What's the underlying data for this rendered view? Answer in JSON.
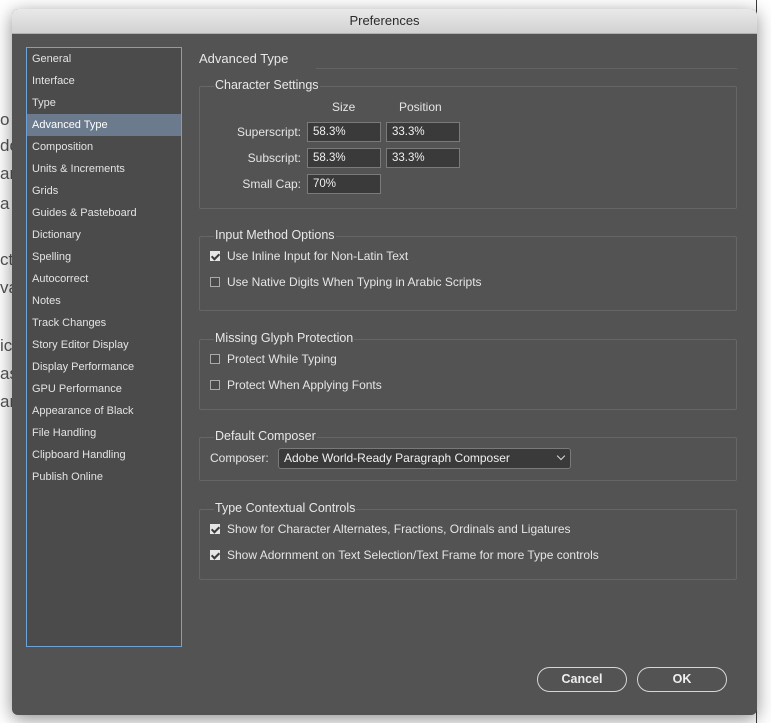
{
  "window": {
    "title": "Preferences"
  },
  "background_fragments": [
    "o",
    "do",
    "an",
    "a",
    "ct",
    "va",
    "ic",
    "as",
    "ar"
  ],
  "sidebar": {
    "items": [
      {
        "label": "General"
      },
      {
        "label": "Interface"
      },
      {
        "label": "Type"
      },
      {
        "label": "Advanced Type",
        "selected": true
      },
      {
        "label": "Composition"
      },
      {
        "label": "Units & Increments"
      },
      {
        "label": "Grids"
      },
      {
        "label": "Guides & Pasteboard"
      },
      {
        "label": "Dictionary"
      },
      {
        "label": "Spelling"
      },
      {
        "label": "Autocorrect"
      },
      {
        "label": "Notes"
      },
      {
        "label": "Track Changes"
      },
      {
        "label": "Story Editor Display"
      },
      {
        "label": "Display Performance"
      },
      {
        "label": "GPU Performance"
      },
      {
        "label": "Appearance of Black"
      },
      {
        "label": "File Handling"
      },
      {
        "label": "Clipboard Handling"
      },
      {
        "label": "Publish Online"
      }
    ]
  },
  "panel": {
    "title": "Advanced Type",
    "character_settings": {
      "title": "Character Settings",
      "size_header": "Size",
      "position_header": "Position",
      "superscript_label": "Superscript:",
      "superscript_size": "58.3%",
      "superscript_position": "33.3%",
      "subscript_label": "Subscript:",
      "subscript_size": "58.3%",
      "subscript_position": "33.3%",
      "smallcap_label": "Small Cap:",
      "smallcap_value": "70%"
    },
    "input_method": {
      "title": "Input Method Options",
      "inline_input_label": "Use Inline Input for Non-Latin Text",
      "inline_input_checked": true,
      "native_digits_label": "Use Native Digits When Typing in Arabic Scripts",
      "native_digits_checked": false
    },
    "missing_glyph": {
      "title": "Missing Glyph Protection",
      "while_typing_label": "Protect While Typing",
      "while_typing_checked": false,
      "applying_fonts_label": "Protect When Applying Fonts",
      "applying_fonts_checked": false
    },
    "default_composer": {
      "title": "Default Composer",
      "composer_label": "Composer:",
      "composer_value": "Adobe World-Ready Paragraph Composer"
    },
    "contextual_controls": {
      "title": "Type Contextual Controls",
      "character_alternates_label": "Show for Character Alternates, Fractions, Ordinals and Ligatures",
      "character_alternates_checked": true,
      "adornment_label": "Show Adornment on Text Selection/Text Frame for more Type controls",
      "adornment_checked": true
    }
  },
  "buttons": {
    "cancel": "Cancel",
    "ok": "OK"
  }
}
